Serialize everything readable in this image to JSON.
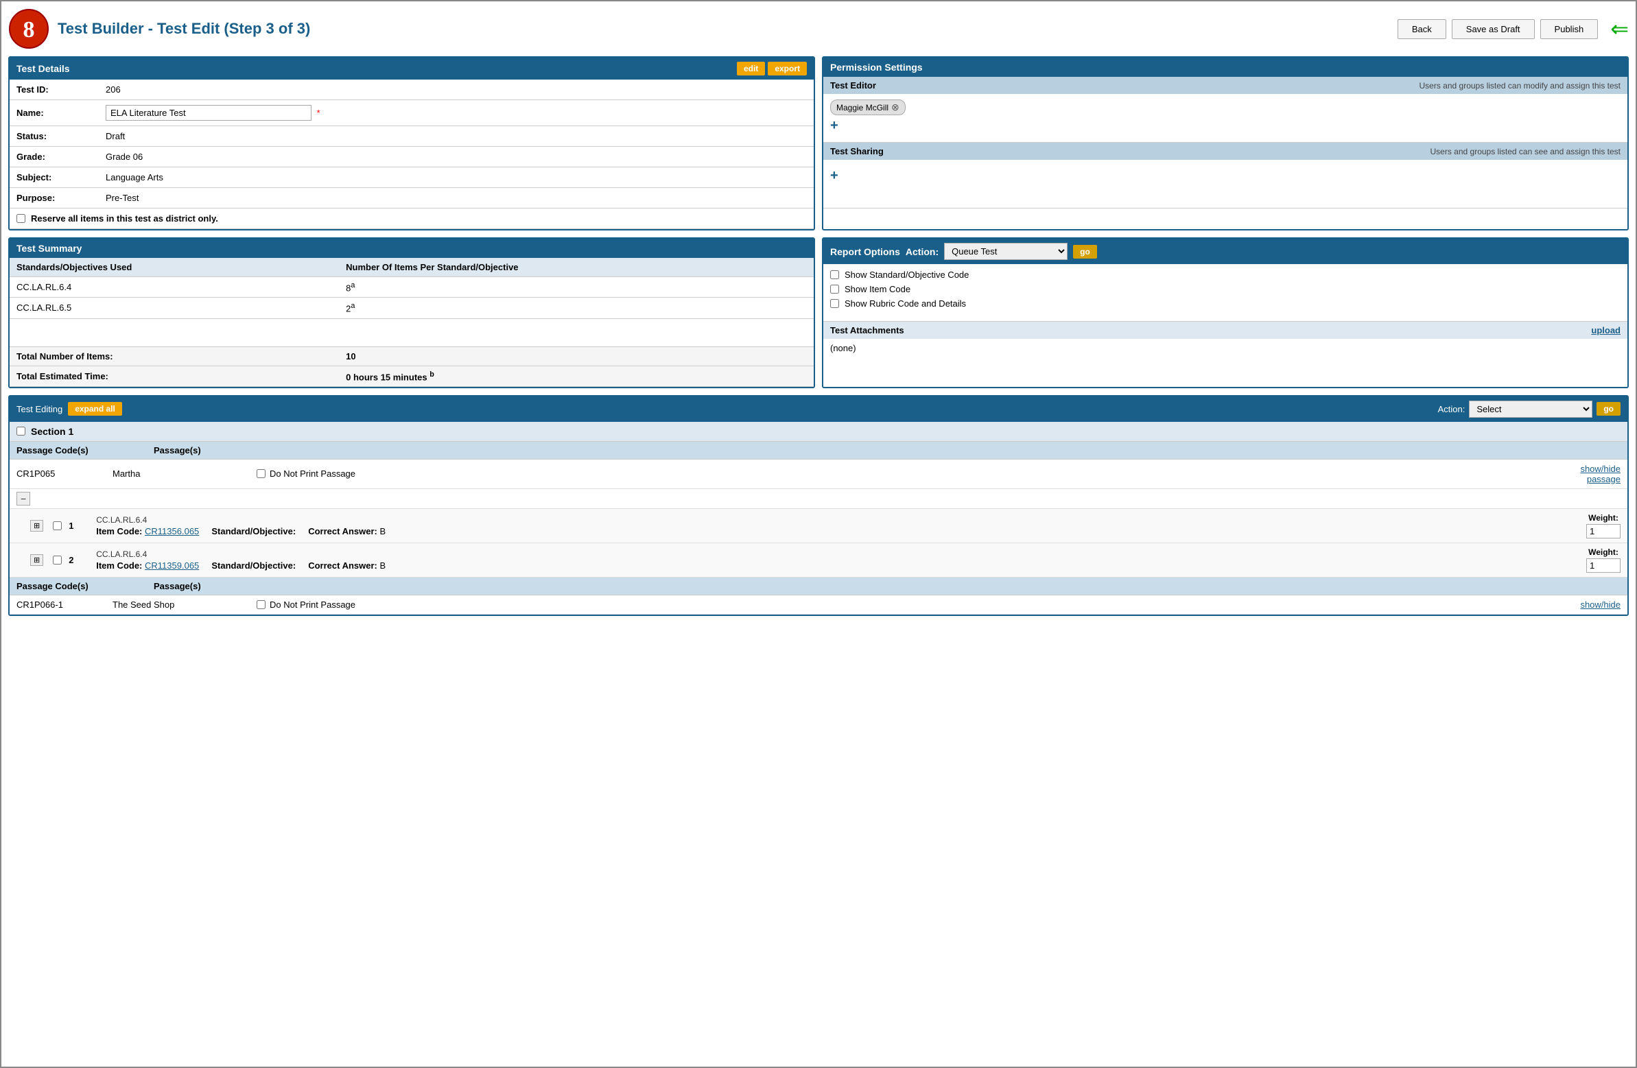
{
  "page": {
    "title": "Test Builder - Test Edit (Step 3 of 3)"
  },
  "header_buttons": {
    "back": "Back",
    "save_as_draft": "Save as Draft",
    "publish": "Publish"
  },
  "test_details": {
    "panel_title": "Test Details",
    "edit_label": "edit",
    "export_label": "export",
    "fields": {
      "test_id_label": "Test ID:",
      "test_id_value": "206",
      "name_label": "Name:",
      "name_value": "ELA Literature Test",
      "name_required": "*",
      "status_label": "Status:",
      "status_value": "Draft",
      "grade_label": "Grade:",
      "grade_value": "Grade 06",
      "subject_label": "Subject:",
      "subject_value": "Language Arts",
      "purpose_label": "Purpose:",
      "purpose_value": "Pre-Test",
      "reserve_label": "Reserve all items in this test as district only."
    }
  },
  "permission_settings": {
    "panel_title": "Permission Settings",
    "test_editor": {
      "section_title": "Test Editor",
      "description": "Users and groups listed can modify and assign this test",
      "users": [
        "Maggie McGill"
      ],
      "add_label": "+"
    },
    "test_sharing": {
      "section_title": "Test Sharing",
      "description": "Users and groups listed can see and assign this test",
      "users": [],
      "add_label": "+"
    }
  },
  "test_summary": {
    "panel_title": "Test Summary",
    "col_standards": "Standards/Objectives Used",
    "col_items": "Number Of Items Per Standard/Objective",
    "rows": [
      {
        "standard": "CC.LA.RL.6.4",
        "items": "8",
        "superscript": "a"
      },
      {
        "standard": "CC.LA.RL.6.5",
        "items": "2",
        "superscript": "a"
      }
    ],
    "total_items_label": "Total Number of Items:",
    "total_items_value": "10",
    "total_time_label": "Total Estimated Time:",
    "total_time_value": "0 hours 15 minutes",
    "total_time_superscript": "b"
  },
  "report_options": {
    "panel_title": "Report Options",
    "action_label": "Action:",
    "action_options": [
      "Queue Test"
    ],
    "action_selected": "Queue Test",
    "go_label": "go",
    "checkboxes": [
      {
        "label": "Show Standard/Objective Code",
        "checked": false
      },
      {
        "label": "Show Item Code",
        "checked": false
      },
      {
        "label": "Show Rubric Code and Details",
        "checked": false
      }
    ],
    "attachments_label": "Test Attachments",
    "upload_label": "upload",
    "attachments_value": "(none)"
  },
  "test_editing": {
    "panel_title": "Test Editing",
    "expand_all_label": "expand all",
    "action_label": "Action:",
    "action_options": [
      "Select"
    ],
    "action_selected": "Select",
    "go_label": "go",
    "sections": [
      {
        "title": "Section 1",
        "passage_code_col": "Passage Code(s)",
        "passage_col": "Passage(s)",
        "passages": [
          {
            "code": "CR1P065",
            "name": "Martha",
            "do_not_print": "Do Not Print Passage",
            "show_hide": "show/hide\npassage",
            "collapsed": true,
            "items": [
              {
                "num": "1",
                "item_code_label": "Item Code:",
                "item_code": "CR11356.065",
                "standard_label": "Standard/Objective:",
                "standard": "CC.LA.RL.6.4",
                "answer_label": "Correct Answer:",
                "answer": "B",
                "weight_label": "Weight:",
                "weight_value": "1"
              },
              {
                "num": "2",
                "item_code_label": "Item Code:",
                "item_code": "CR11359.065",
                "standard_label": "Standard/Objective:",
                "standard": "CC.LA.RL.6.4",
                "answer_label": "Correct Answer:",
                "answer": "B",
                "weight_label": "Weight:",
                "weight_value": "1"
              }
            ]
          }
        ],
        "passage_code_col2": "Passage Code(s)",
        "passage_col2": "Passage(s)",
        "passages2": [
          {
            "code": "CR1P066-1",
            "name": "The Seed Shop",
            "do_not_print": "Do Not Print Passage",
            "show_hide": "show/hide"
          }
        ]
      }
    ]
  }
}
